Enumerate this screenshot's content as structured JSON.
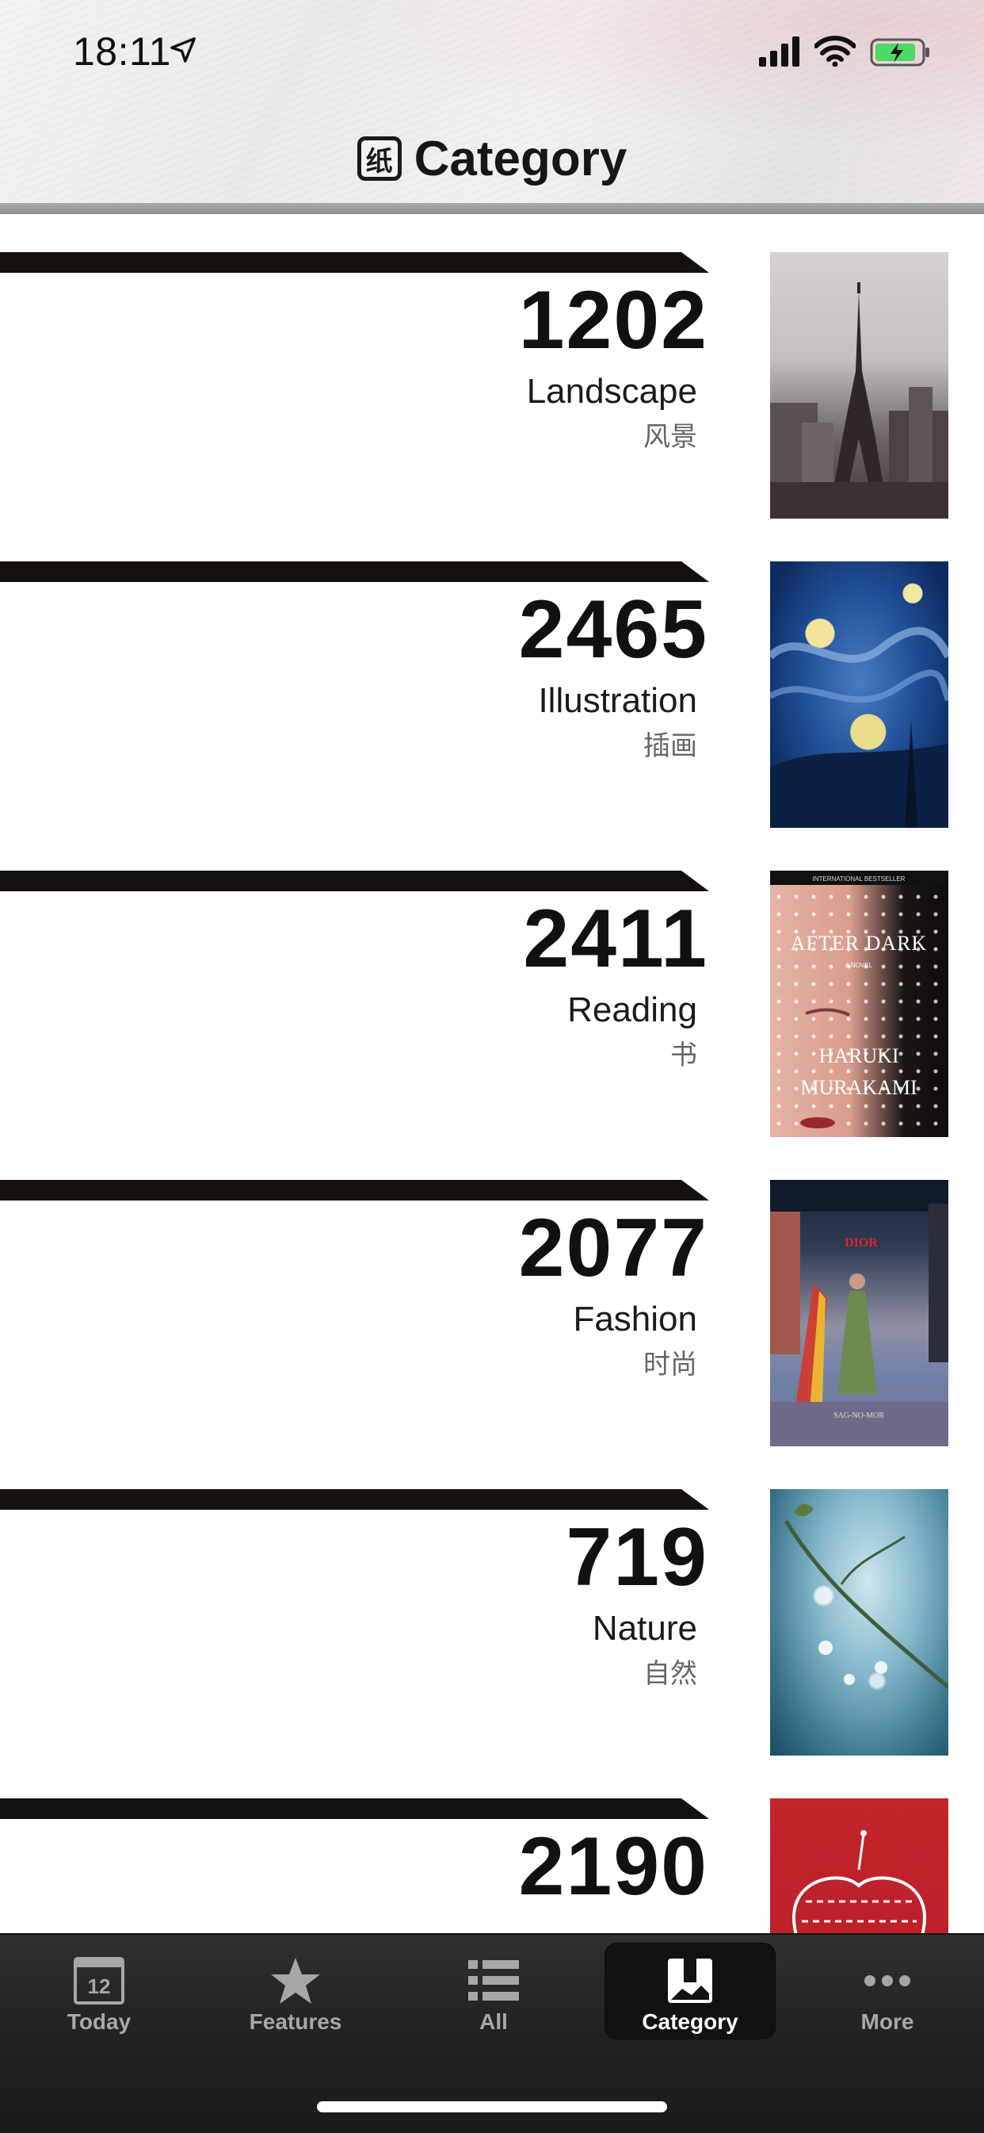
{
  "status_bar": {
    "time": "18:11",
    "icons": [
      "location-arrow-icon",
      "signal-icon",
      "wifi-icon",
      "battery-charging-icon"
    ]
  },
  "header": {
    "logo_glyph": "纸",
    "title": "Category"
  },
  "categories": [
    {
      "count": "1202",
      "name_en": "Landscape",
      "name_cn": "风景"
    },
    {
      "count": "2465",
      "name_en": "Illustration",
      "name_cn": "插画"
    },
    {
      "count": "2411",
      "name_en": "Reading",
      "name_cn": "书"
    },
    {
      "count": "2077",
      "name_en": "Fashion",
      "name_cn": "时尚"
    },
    {
      "count": "719",
      "name_en": "Nature",
      "name_cn": "自然"
    },
    {
      "count": "2190",
      "name_en": "",
      "name_cn": ""
    }
  ],
  "book_cover": {
    "top_line": "INTERNATIONAL BESTSELLER",
    "title": "AFTER DARK",
    "subtitle": "A NOVEL",
    "author_first": "HARUKI",
    "author_last": "MURAKAMI"
  },
  "fashion_cover": {
    "brand": "DIOR",
    "footer": "SAG-NO-MOR"
  },
  "tabbar": {
    "tabs": [
      {
        "label": "Today",
        "icon": "calendar-icon",
        "badge": "12",
        "selected": false
      },
      {
        "label": "Features",
        "icon": "star-icon",
        "selected": false
      },
      {
        "label": "All",
        "icon": "list-icon",
        "selected": false
      },
      {
        "label": "Category",
        "icon": "category-book-icon",
        "selected": true
      },
      {
        "label": "More",
        "icon": "more-dots-icon",
        "selected": false
      }
    ]
  },
  "colors": {
    "bar": "#16100f",
    "tabbar_bg": "#242424",
    "tab_selected_bg": "#121212",
    "tab_inactive_text": "#a7a7a7"
  }
}
